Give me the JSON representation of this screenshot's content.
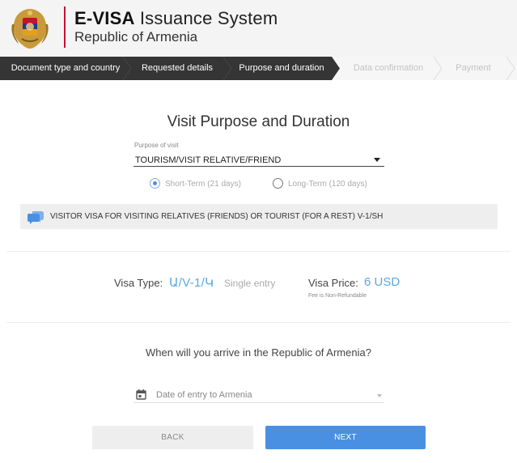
{
  "header": {
    "title_bold": "E-VISA",
    "title_rest": " Issuance System",
    "subtitle": "Republic of Armenia"
  },
  "steps": [
    {
      "label": "Document type and country",
      "state": "active"
    },
    {
      "label": "Requested details",
      "state": "active"
    },
    {
      "label": "Purpose and duration",
      "state": "active"
    },
    {
      "label": "Data confirmation",
      "state": "inactive"
    },
    {
      "label": "Payment",
      "state": "inactive"
    }
  ],
  "form": {
    "title": "Visit Purpose and Duration",
    "purpose_label": "Purpose of visit",
    "purpose_value": "TOURISM/VISIT RELATIVE/FRIEND",
    "duration_options": [
      {
        "label": "Short-Term (21 days)",
        "selected": true
      },
      {
        "label": "Long-Term (120 days)",
        "selected": false
      }
    ],
    "info_text": "VISITOR VISA FOR VISITING RELATIVES (FRIENDS) OR TOURIST (FOR A REST) V-1/SH"
  },
  "visa": {
    "type_label": "Visa Type:",
    "type_value": "Ա/V-1/Կ",
    "entry": "Single entry",
    "price_label": "Visa Price:",
    "price_value": "6 USD",
    "fee_note": "Fee is Non-Refundable"
  },
  "arrival": {
    "question": "When will you arrive in the Republic of Armenia?",
    "date_placeholder": "Date of entry to Armenia"
  },
  "buttons": {
    "back": "BACK",
    "next": "NEXT"
  },
  "colors": {
    "accent": "#4a90e2",
    "visa_value": "#5aa8e0",
    "steps_active": "#353535",
    "header_divider": "#c8102e"
  },
  "icons": {
    "emblem": "armenia-coat-of-arms",
    "info": "chat-bubbles-icon",
    "date": "calendar-icon"
  }
}
